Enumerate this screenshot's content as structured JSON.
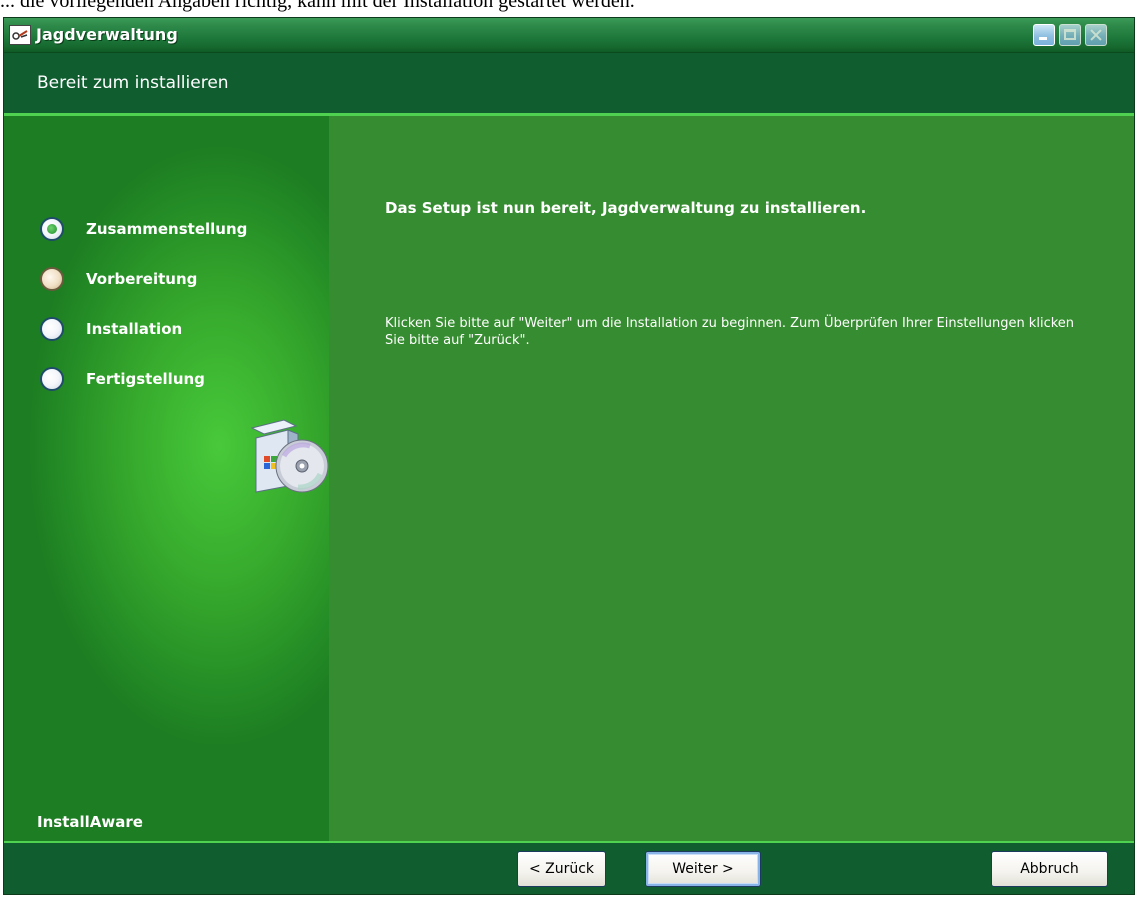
{
  "background_doc": {
    "text": "... die vorliegenden Angaben richtig, kann mit der Installation gestartet werden."
  },
  "window": {
    "title": "Jagdverwaltung",
    "controls": [
      "minimize",
      "maximize",
      "close"
    ]
  },
  "header": {
    "title": "Bereit zum installieren"
  },
  "sidebar": {
    "steps": [
      {
        "label": "Zusammenstellung",
        "state": "active"
      },
      {
        "label": "Vorbereitung",
        "state": "pending"
      },
      {
        "label": "Installation",
        "state": "todo"
      },
      {
        "label": "Fertigstellung",
        "state": "todo"
      }
    ],
    "brand": "InstallAware"
  },
  "content": {
    "heading": "Das Setup ist nun bereit, Jagdverwaltung zu installieren.",
    "body": "Klicken Sie bitte auf \"Weiter\" um die Installation zu beginnen. Zum Überprüfen Ihrer Einstellungen klicken Sie bitte auf \"Zurück\"."
  },
  "footer": {
    "back_label": "< Zurück",
    "next_label": "Weiter >",
    "cancel_label": "Abbruch"
  },
  "colors": {
    "titlebar": "#1f7a3c",
    "header": "#105e30",
    "sidebar": "#37ab2d",
    "content": "#368c30",
    "accent_line": "#4fd24f"
  },
  "icons": [
    "app-icon",
    "minimize-icon",
    "maximize-icon",
    "close-icon",
    "software-box-icon"
  ]
}
